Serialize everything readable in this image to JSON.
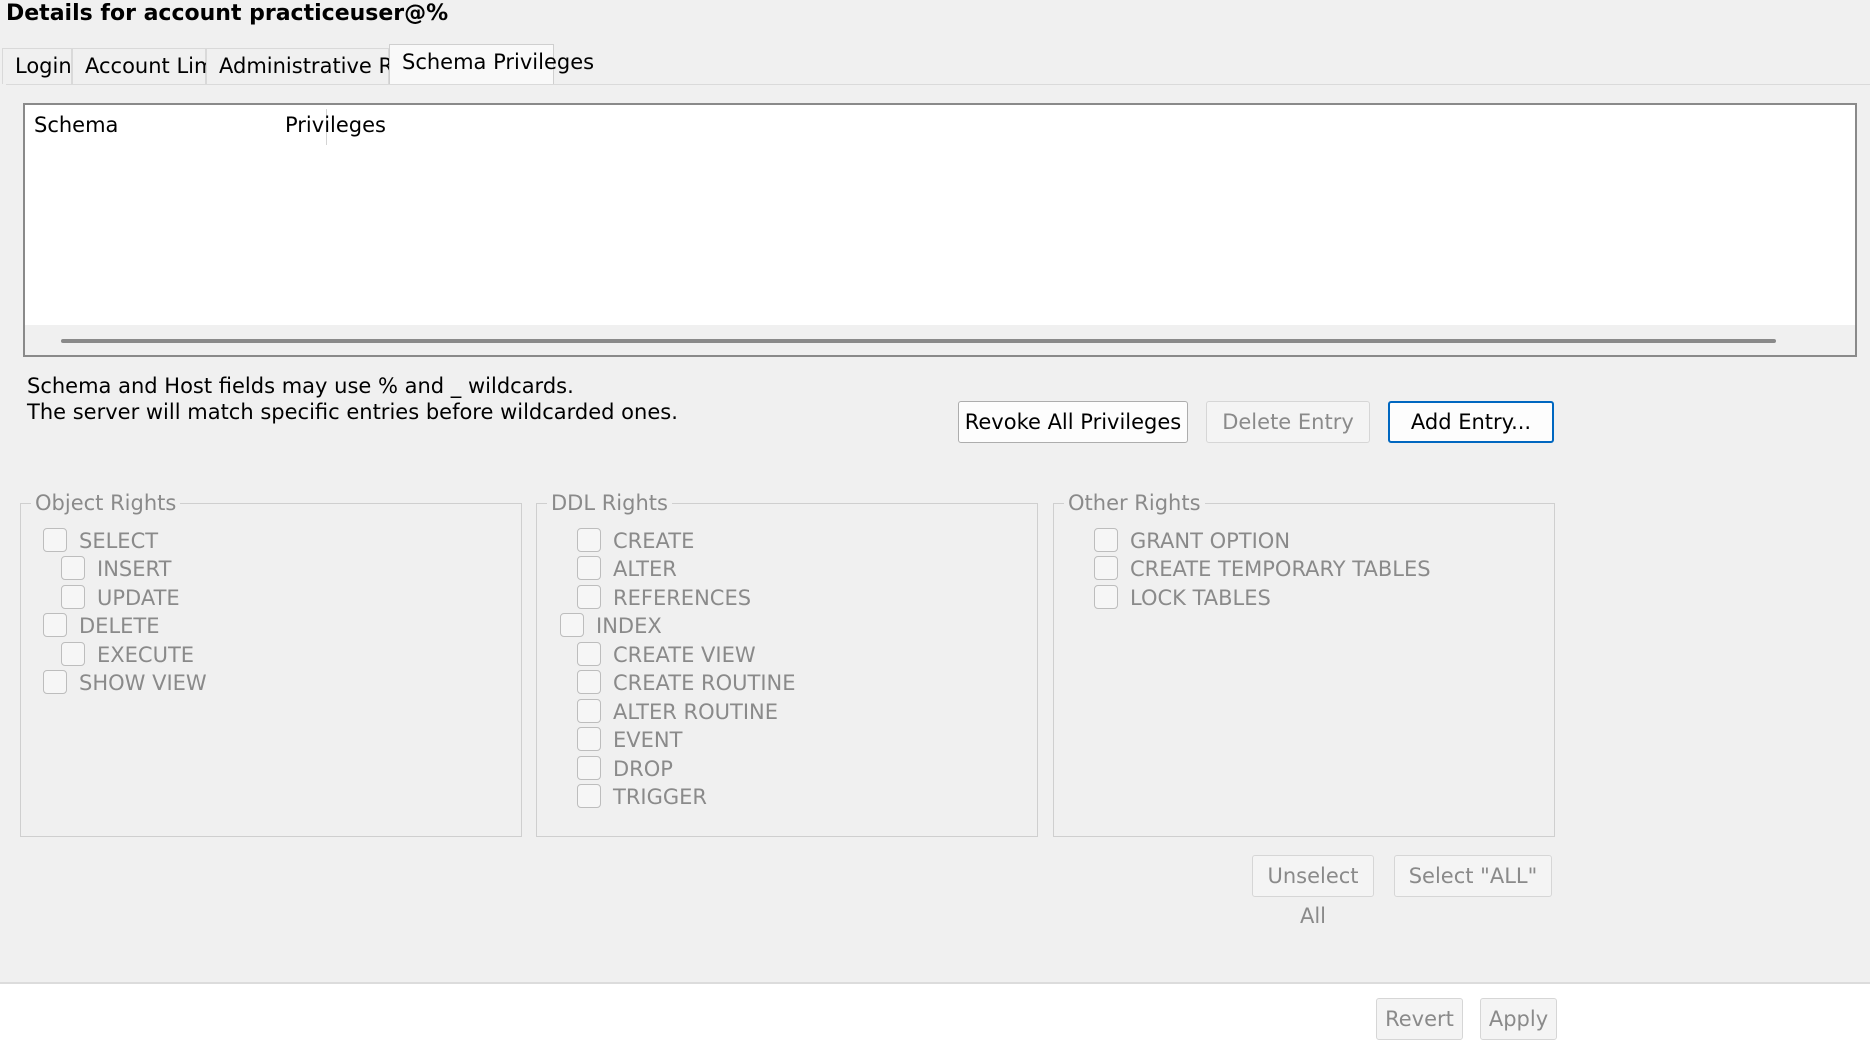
{
  "title": "Details for account practiceuser@%",
  "tabs": [
    {
      "label": "Login"
    },
    {
      "label": "Account Limits"
    },
    {
      "label": "Administrative Roles"
    },
    {
      "label": "Schema Privileges",
      "active": true
    }
  ],
  "table": {
    "columns": [
      "Schema",
      "Privileges"
    ],
    "rows": []
  },
  "hint": {
    "line1": "Schema and Host fields may use % and _ wildcards.",
    "line2": "The server will match specific entries before wildcarded ones."
  },
  "buttons": {
    "revoke_all": "Revoke All Privileges",
    "delete_entry": "Delete Entry",
    "add_entry": "Add Entry...",
    "unselect_all": "Unselect All",
    "select_all": "Select \"ALL\"",
    "revert": "Revert",
    "apply": "Apply"
  },
  "groups": {
    "object_rights": {
      "title": "Object Rights",
      "items": [
        "SELECT",
        "INSERT",
        "UPDATE",
        "DELETE",
        "EXECUTE",
        "SHOW VIEW"
      ]
    },
    "ddl_rights": {
      "title": "DDL Rights",
      "items": [
        "CREATE",
        "ALTER",
        "REFERENCES",
        "INDEX",
        "CREATE VIEW",
        "CREATE ROUTINE",
        "ALTER ROUTINE",
        "EVENT",
        "DROP",
        "TRIGGER"
      ]
    },
    "other_rights": {
      "title": "Other Rights",
      "items": [
        "GRANT OPTION",
        "CREATE TEMPORARY TABLES",
        "LOCK TABLES"
      ]
    }
  },
  "colors": {
    "accent": "#0067c0",
    "disabled_text": "#8a8a8a",
    "background": "#f0f0f0"
  }
}
